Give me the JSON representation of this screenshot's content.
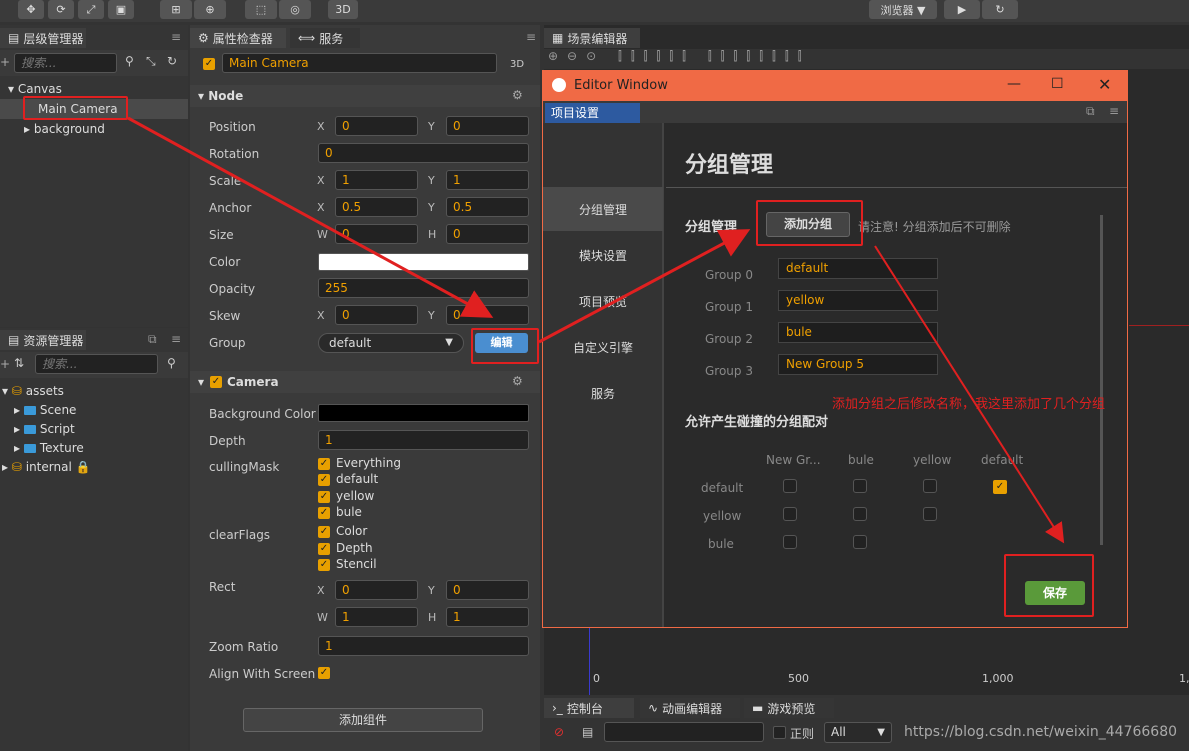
{
  "toolbar": {
    "mode_3d": "3D",
    "browser_label": "浏览器 ▼"
  },
  "hierarchy": {
    "title": "层级管理器",
    "search_placeholder": "搜索...",
    "items": [
      "Canvas",
      "Main Camera",
      "background"
    ]
  },
  "assets": {
    "title": "资源管理器",
    "search_placeholder": "搜索...",
    "items": [
      "assets",
      "Scene",
      "Script",
      "Texture",
      "internal"
    ]
  },
  "inspector": {
    "tab_inspector": "属性检查器",
    "tab_service": "服务",
    "node_name": "Main Camera",
    "badge_3d": "3D",
    "node": {
      "title": "Node",
      "position": {
        "label": "Position",
        "x": "0",
        "y": "0"
      },
      "rotation": {
        "label": "Rotation",
        "value": "0"
      },
      "scale": {
        "label": "Scale",
        "x": "1",
        "y": "1"
      },
      "anchor": {
        "label": "Anchor",
        "x": "0.5",
        "y": "0.5"
      },
      "size": {
        "label": "Size",
        "w": "0",
        "h": "0"
      },
      "color_label": "Color",
      "opacity": {
        "label": "Opacity",
        "value": "255"
      },
      "skew": {
        "label": "Skew",
        "x": "0",
        "y": "0"
      },
      "group": {
        "label": "Group",
        "value": "default",
        "edit": "编辑"
      }
    },
    "camera": {
      "title": "Camera",
      "bg_color_label": "Background Color",
      "depth": {
        "label": "Depth",
        "value": "1"
      },
      "culling_label": "cullingMask",
      "culling": [
        "Everything",
        "default",
        "yellow",
        "bule"
      ],
      "clear_label": "clearFlags",
      "clear": [
        "Color",
        "Depth",
        "Stencil"
      ],
      "rect": {
        "label": "Rect",
        "x": "0",
        "y": "0",
        "w": "1",
        "h": "1"
      },
      "zoom": {
        "label": "Zoom Ratio",
        "value": "1"
      },
      "align_label": "Align With Screen"
    },
    "add_component": "添加组件",
    "axes": {
      "x": "X",
      "y": "Y",
      "w": "W",
      "h": "H"
    }
  },
  "scene": {
    "title": "场景编辑器",
    "ruler": [
      "0",
      "500",
      "1,000",
      "1,"
    ]
  },
  "console": {
    "tab_console": "控制台",
    "tab_anim": "动画编辑器",
    "tab_preview": "游戏预览",
    "regex": "正则",
    "filter": "All",
    "url": "https://blog.csdn.net/weixin_44766680"
  },
  "editor": {
    "title": "Editor Window",
    "tab": "项目设置",
    "nav": [
      "分组管理",
      "模块设置",
      "项目预览",
      "自定义引擎",
      "服务"
    ],
    "heading": "分组管理",
    "group_label": "分组管理",
    "add_group": "添加分组",
    "warning": "请注意! 分组添加后不可删除",
    "groups": [
      {
        "label": "Group 0",
        "name": "default"
      },
      {
        "label": "Group 1",
        "name": "yellow"
      },
      {
        "label": "Group 2",
        "name": "bule"
      },
      {
        "label": "Group 3",
        "name": "New Group 5"
      }
    ],
    "collision_title": "允许产生碰撞的分组配对",
    "col_headers": [
      "New Gr...",
      "bule",
      "yellow",
      "default"
    ],
    "row_headers": [
      "default",
      "yellow",
      "bule"
    ],
    "save": "保存"
  },
  "annotation": "添加分组之后修改名称，我这里添加了几个分组",
  "colors": {
    "accent": "#e8a000",
    "edit_blue": "#4a8ed0",
    "save_green": "#5a9a3a",
    "annot_red": "#e02020",
    "titlebar": "#f06a45"
  }
}
